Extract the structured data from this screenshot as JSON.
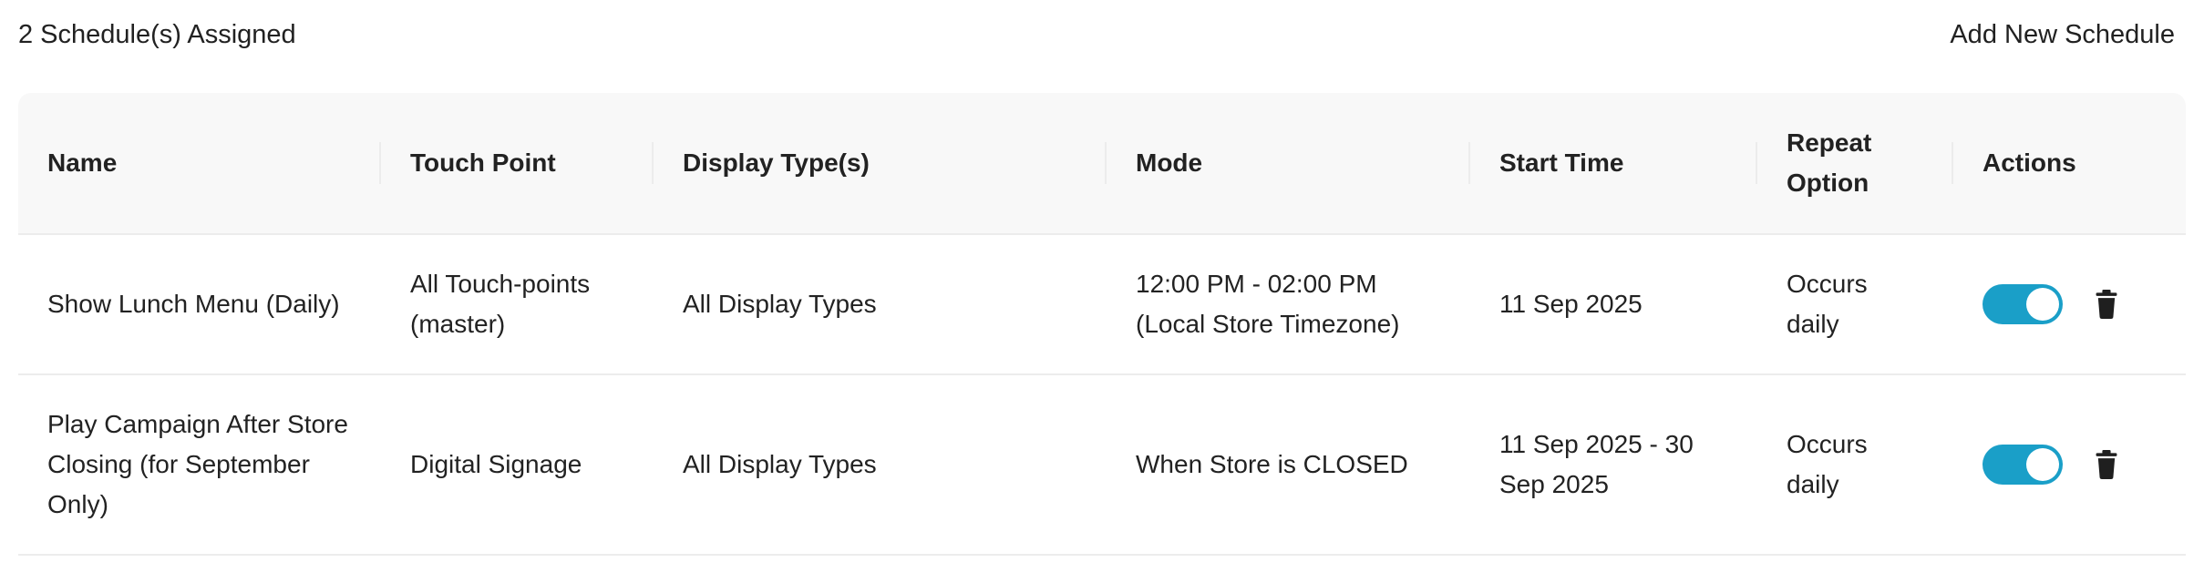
{
  "header": {
    "count_label": "2 Schedule(s) Assigned",
    "add_button_label": "Add New Schedule"
  },
  "table": {
    "columns": [
      "Name",
      "Touch Point",
      "Display Type(s)",
      "Mode",
      "Start Time",
      "Repeat Option",
      "Actions"
    ],
    "rows": [
      {
        "name": "Show Lunch Menu (Daily)",
        "touch_point": "All Touch-points (master)",
        "display_types": "All Display Types",
        "mode": "12:00 PM - 02:00 PM (Local Store Timezone)",
        "start_time": "11 Sep 2025",
        "repeat_option": "Occurs daily",
        "enabled": true,
        "toggle_icon": "toggle-on-icon",
        "delete_icon": "trash-icon"
      },
      {
        "name": "Play Campaign After Store Closing (for September Only)",
        "touch_point": "Digital Signage",
        "display_types": "All Display Types",
        "mode": "When Store is CLOSED",
        "start_time": "11 Sep 2025 - 30 Sep 2025",
        "repeat_option": "Occurs daily",
        "enabled": true,
        "toggle_icon": "toggle-on-icon",
        "delete_icon": "trash-icon"
      }
    ]
  },
  "colors": {
    "toggle_on": "#1a9fc8",
    "header_bg": "#f8f8f8",
    "divider": "#ececec"
  }
}
